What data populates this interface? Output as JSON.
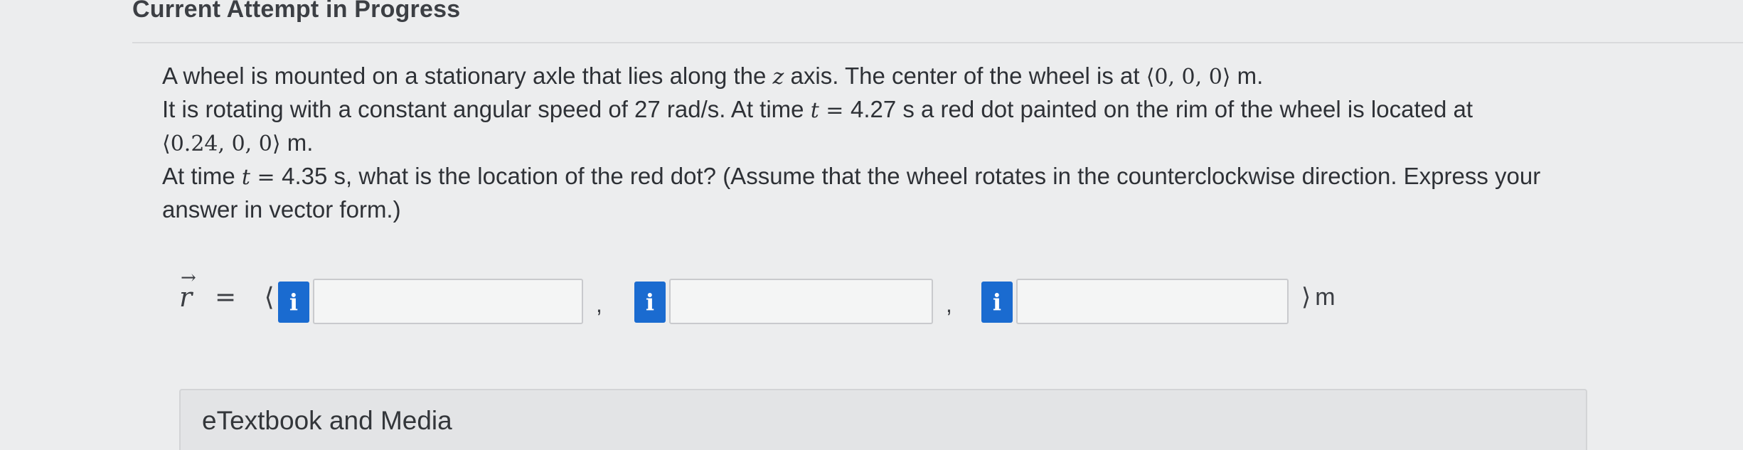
{
  "header": {
    "title": "Current Attempt in Progress"
  },
  "question": {
    "line1_text": "A wheel is mounted on a stationary axle that lies along the ",
    "line1_var": "z",
    "line1_mid": " axis. The center of the wheel is at ",
    "line1_vec": "⟨0, 0, 0⟩",
    "line1_unit": " m.",
    "line2_text": "It is rotating with a constant angular speed of 27 rad/s. At time ",
    "line2_var": "t",
    "line2_eq": " = ",
    "line2_rest": " 4.27 s a red dot painted on the rim of the wheel is located at",
    "line3_vec": "⟨0.24, 0, 0⟩",
    "line3_unit": " m.",
    "line4_text": "At time ",
    "line4_var": "t",
    "line4_eq": " = ",
    "line4_rest": " 4.35 s, what is the location of the red dot? (Assume that the wheel rotates in the counterclockwise direction. Express your",
    "line5_text": "answer in vector form.)"
  },
  "answer": {
    "vector_symbol": "r",
    "vector_arrow": "→",
    "equals_open": "= ⟨",
    "info_icon_glyph": "i",
    "separator": ",",
    "close_angle": "⟩",
    "unit": "m",
    "field_x_value": "",
    "field_y_value": "",
    "field_z_value": ""
  },
  "etextbook": {
    "label": "eTextbook and Media"
  },
  "colors": {
    "background": "#ecedee",
    "info_button": "#1a6bd0",
    "field_border": "#c9cacd"
  }
}
